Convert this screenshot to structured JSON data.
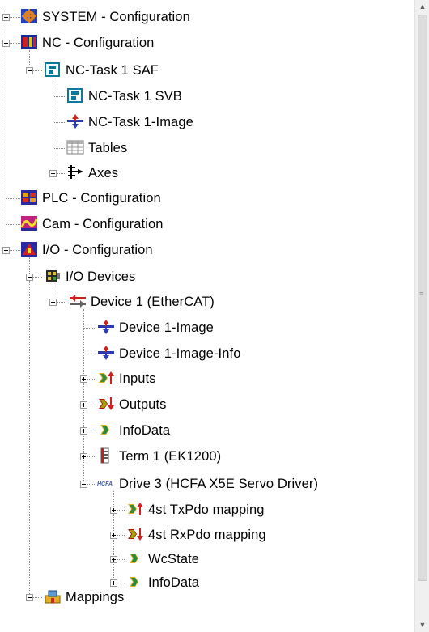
{
  "tree": {
    "items": [
      {
        "label": "SYSTEM - Configuration",
        "icon": "system-config-icon",
        "expand": "plus"
      },
      {
        "label": "NC - Configuration",
        "icon": "nc-config-icon",
        "expand": "minus"
      },
      {
        "label": "NC-Task 1 SAF",
        "icon": "nc-task-icon",
        "expand": "minus"
      },
      {
        "label": "NC-Task 1 SVB",
        "icon": "nc-task-icon",
        "expand": "none"
      },
      {
        "label": "NC-Task 1-Image",
        "icon": "image-icon",
        "expand": "none"
      },
      {
        "label": "Tables",
        "icon": "table-icon",
        "expand": "none"
      },
      {
        "label": "Axes",
        "icon": "axes-icon",
        "expand": "plus"
      },
      {
        "label": "PLC - Configuration",
        "icon": "plc-config-icon",
        "expand": "none"
      },
      {
        "label": "Cam - Configuration",
        "icon": "cam-config-icon",
        "expand": "none"
      },
      {
        "label": "I/O - Configuration",
        "icon": "io-config-icon",
        "expand": "minus"
      },
      {
        "label": "I/O Devices",
        "icon": "io-devices-icon",
        "expand": "minus"
      },
      {
        "label": "Device 1 (EtherCAT)",
        "icon": "ethercat-device-icon",
        "expand": "minus"
      },
      {
        "label": "Device 1-Image",
        "icon": "image-icon",
        "expand": "none"
      },
      {
        "label": "Device 1-Image-Info",
        "icon": "image-icon",
        "expand": "none"
      },
      {
        "label": "Inputs",
        "icon": "inputs-icon",
        "expand": "plus"
      },
      {
        "label": "Outputs",
        "icon": "outputs-icon",
        "expand": "plus"
      },
      {
        "label": "InfoData",
        "icon": "infodata-icon",
        "expand": "plus"
      },
      {
        "label": "Term 1 (EK1200)",
        "icon": "terminal-icon",
        "expand": "plus"
      },
      {
        "label": "Drive 3 (HCFA X5E Servo Driver)",
        "icon": "hcfa-drive-icon",
        "expand": "minus"
      },
      {
        "label": "4st TxPdo mapping",
        "icon": "inputs-icon",
        "expand": "plus"
      },
      {
        "label": "4st RxPdo mapping",
        "icon": "outputs-icon",
        "expand": "plus"
      },
      {
        "label": "WcState",
        "icon": "infodata-icon",
        "expand": "plus"
      },
      {
        "label": "InfoData",
        "icon": "infodata-icon",
        "expand": "plus"
      },
      {
        "label": "Mappings",
        "icon": "mappings-icon",
        "expand": "minus"
      }
    ]
  },
  "scrollbar": {
    "up_glyph": "▲",
    "down_glyph": "▼",
    "grip_glyph": "≡"
  }
}
